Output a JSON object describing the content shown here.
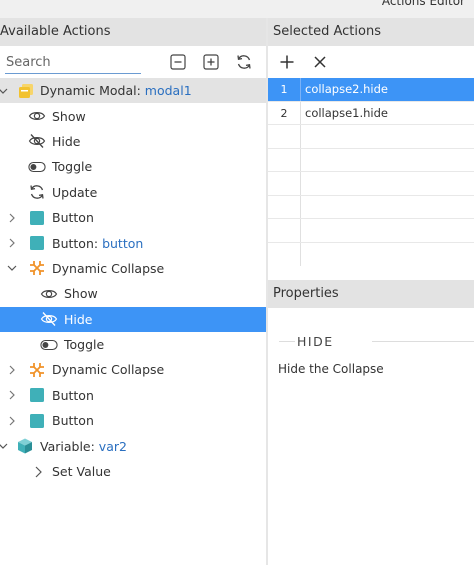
{
  "window": {
    "title": "Actions Editor"
  },
  "left_panel": {
    "header": "Available Actions",
    "search": {
      "value": "",
      "placeholder": "Search"
    },
    "toolbar": {
      "collapse_icon": "minus-square-icon",
      "expand_icon": "plus-square-icon",
      "refresh_icon": "refresh-icon"
    },
    "tree": [
      {
        "label": "Dynamic Modal: ",
        "name": "modal1",
        "icon": "modal-icon",
        "arrow": "expanded"
      },
      {
        "label": "Show",
        "icon": "eye-icon"
      },
      {
        "label": "Hide",
        "icon": "eye-slash-icon"
      },
      {
        "label": "Toggle",
        "icon": "toggle-icon"
      },
      {
        "label": "Update",
        "icon": "refresh-icon"
      },
      {
        "label": "Button",
        "icon": "button-icon",
        "arrow": "collapsed"
      },
      {
        "label": "Button: ",
        "name": "button",
        "icon": "button-icon",
        "arrow": "collapsed"
      },
      {
        "label": "Dynamic Collapse",
        "icon": "collapse-icon",
        "arrow": "expanded"
      },
      {
        "label": "Show",
        "icon": "eye-icon"
      },
      {
        "label": "Hide",
        "icon": "eye-slash-icon"
      },
      {
        "label": "Toggle",
        "icon": "toggle-icon"
      },
      {
        "label": "Dynamic Collapse",
        "icon": "collapse-icon",
        "arrow": "collapsed"
      },
      {
        "label": "Button",
        "icon": "button-icon",
        "arrow": "collapsed"
      },
      {
        "label": "Button",
        "icon": "button-icon",
        "arrow": "collapsed"
      },
      {
        "label": "Variable: ",
        "name": "var2",
        "icon": "cube-icon",
        "arrow": "expanded"
      },
      {
        "label": "Set Value",
        "icon": "chevron-right-icon"
      }
    ]
  },
  "right_panel": {
    "header": "Selected Actions",
    "toolbar": {
      "add_icon": "plus-icon",
      "remove_icon": "close-icon"
    },
    "rows": [
      {
        "num": "1",
        "value": "collapse2.hide"
      },
      {
        "num": "2",
        "value": "collapse1.hide"
      },
      {
        "num": "",
        "value": ""
      },
      {
        "num": "",
        "value": ""
      },
      {
        "num": "",
        "value": ""
      },
      {
        "num": "",
        "value": ""
      },
      {
        "num": "",
        "value": ""
      },
      {
        "num": "",
        "value": ""
      }
    ],
    "properties": {
      "header": "Properties",
      "section_title": "HIDE",
      "description": "Hide the Collapse"
    }
  },
  "colors": {
    "selection": "#3d94f6",
    "header_bg": "#e3e3e3",
    "link": "#2a6fc0",
    "collapse_icon": "#f0932b",
    "teal_icon": "#3fb0b8",
    "modal_icon": "#f2c230"
  }
}
